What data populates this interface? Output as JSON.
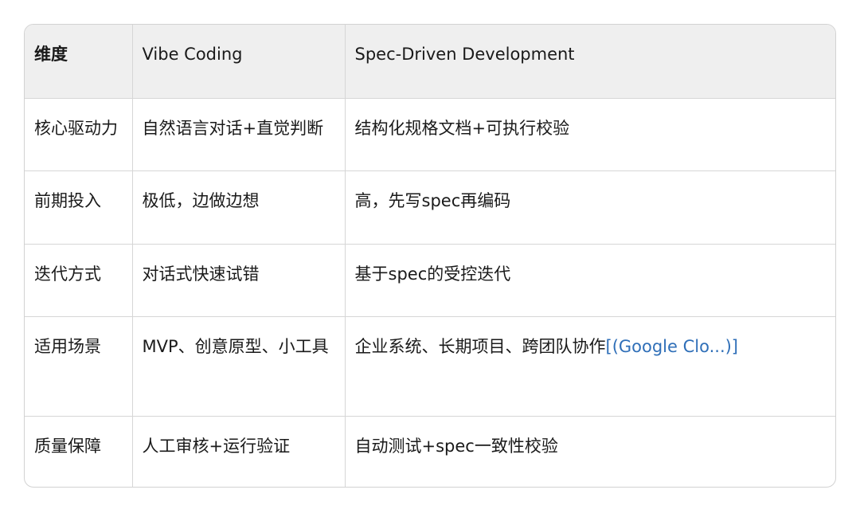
{
  "table": {
    "headers": [
      "维度",
      "Vibe Coding",
      "Spec-Driven Development"
    ],
    "rows": [
      {
        "dimension": "核心驱动力",
        "vibe": "自然语言对话+直觉判断",
        "spec": "结构化规格文档+可执行校验"
      },
      {
        "dimension": "前期投入",
        "vibe": "极低，边做边想",
        "spec": "高，先写spec再编码"
      },
      {
        "dimension": "迭代方式",
        "vibe": "对话式快速试错",
        "spec": "基于spec的受控迭代"
      },
      {
        "dimension": "适用场景",
        "vibe": "MVP、创意原型、小工具",
        "spec": "企业系统、长期项目、跨团队协作",
        "spec_citation": "[(Google Clo...)]"
      },
      {
        "dimension": "质量保障",
        "vibe": "人工审核+运行验证",
        "spec": "自动测试+spec一致性校验"
      }
    ]
  },
  "colors": {
    "header_bg": "#efefef",
    "border": "#d6d6d6",
    "link": "#2f6fb8",
    "text": "#1a1a1a"
  }
}
